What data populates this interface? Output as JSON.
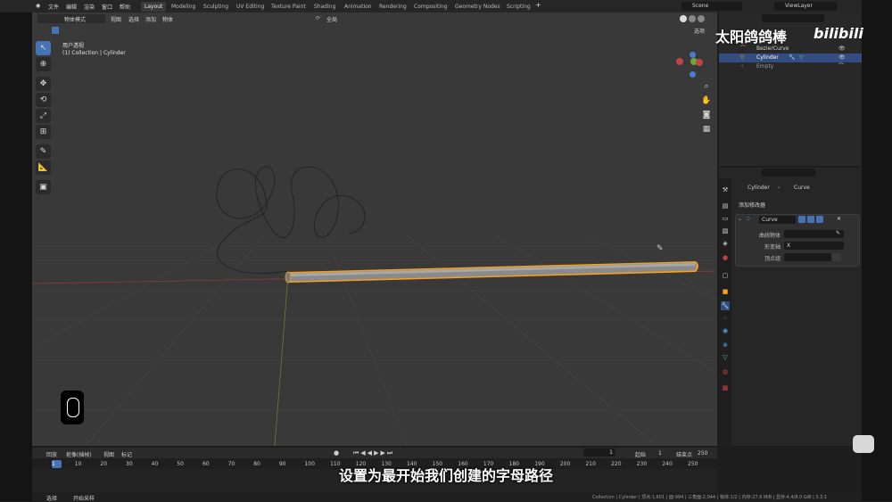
{
  "topbar": {
    "menus": [
      "文件",
      "编辑",
      "渲染",
      "窗口",
      "帮助"
    ],
    "workspaces": [
      "Layout",
      "Modeling",
      "Sculpting",
      "UV Editing",
      "Texture Paint",
      "Shading",
      "Animation",
      "Rendering",
      "Compositing",
      "Geometry Nodes",
      "Scripting"
    ],
    "active_workspace": "Layout",
    "scene": "Scene",
    "view_layer": "ViewLayer"
  },
  "viewport": {
    "mode": "物体模式",
    "menus": [
      "视图",
      "选择",
      "添加",
      "物体"
    ],
    "transform": "全局",
    "options": "选项",
    "view_name": "用户透视",
    "collection_label": "(1) Collection | Cylinder"
  },
  "outliner": {
    "items": [
      {
        "name": "BezierCurve",
        "selected": false
      },
      {
        "name": "Cylinder",
        "selected": true
      },
      {
        "name": "Empty",
        "selected": false
      }
    ]
  },
  "properties": {
    "breadcrumb_object": "Cylinder",
    "breadcrumb_modifier": "Curve",
    "add_modifier": "添加修改器",
    "modifier_name": "Curve",
    "curve_object_label": "曲线物体",
    "deform_axis_label": "形变轴",
    "deform_axis_value": "X",
    "vertex_group_label": "顶点组"
  },
  "timeline": {
    "menus": [
      "回放",
      "抠像(插帧)",
      "视图",
      "标记"
    ],
    "current_frame": "1",
    "start_label": "起始",
    "start_value": "1",
    "end_label": "结束点",
    "end_value": "250",
    "ticks": [
      "1",
      "10",
      "20",
      "30",
      "40",
      "50",
      "60",
      "70",
      "80",
      "90",
      "100",
      "110",
      "120",
      "130",
      "140",
      "150",
      "160",
      "170",
      "180",
      "190",
      "200",
      "210",
      "220",
      "230",
      "240",
      "250"
    ]
  },
  "statusbar": {
    "left1": "选择",
    "left2": "开始采样",
    "right": "Collection | Cylinder | 顶点:1,601 | 面:994 | 三角面:2,044 | 物体:1/2 | 内存:27.6 MiB | 显存:4.4/8.0 GiB | 3.3.1"
  },
  "overlay": {
    "watermark": "太阳鸽鸽棒",
    "brand": "bilibili",
    "subtitle": "设置为最开始我们创建的字母路径"
  },
  "colors": {
    "accent": "#4772b3",
    "selection": "#f5a023",
    "active_row": "#334d80"
  }
}
